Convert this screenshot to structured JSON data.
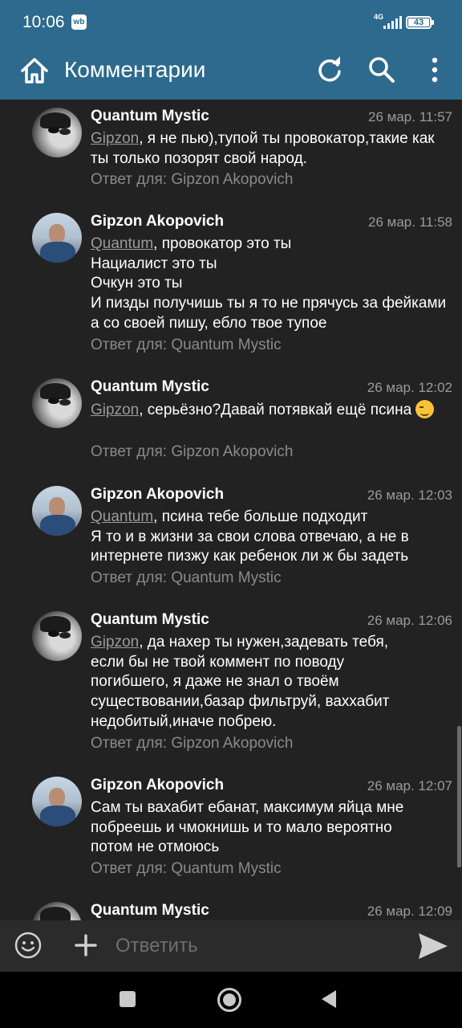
{
  "status_bar": {
    "time": "10:06",
    "app_badge": "wb",
    "network": "4G",
    "battery": "43"
  },
  "app_bar": {
    "title": "Комментарии"
  },
  "reply_prefix": "Ответ для: ",
  "comments": [
    {
      "author": "Quantum Mystic",
      "date": "26 мар. 11:57",
      "mention": "Gipzon",
      "text": ", я не пью),тупой ты провокатор,такие как ты только позорят свой народ.",
      "reply_to": "Gipzon Akopovich"
    },
    {
      "author": "Gipzon Akopovich",
      "date": "26 мар. 11:58",
      "mention": "Quantum",
      "text": ", провокатор это ты\nНациалист это ты\nОчкун это ты\nИ пизды получишь ты я то не прячусь за фейками а со своей пишу, ебло твое тупое",
      "reply_to": "Quantum Mystic"
    },
    {
      "author": "Quantum Mystic",
      "date": "26 мар. 12:02",
      "mention": "Gipzon",
      "text": ", серьёзно?Давай потявкай ещё псина",
      "emoji": "wink",
      "reply_to": "Gipzon Akopovich"
    },
    {
      "author": "Gipzon Akopovich",
      "date": "26 мар. 12:03",
      "mention": "Quantum",
      "text": ", псина тебе больше подходит\nЯ то и в жизни за свои слова отвечаю, а не в интернете пизжу как ребенок ли ж бы задеть",
      "reply_to": "Quantum Mystic"
    },
    {
      "author": "Quantum Mystic",
      "date": "26 мар. 12:06",
      "mention": "Gipzon",
      "text": ", да нахер ты нужен,задевать тебя, если бы не твой коммент по поводу погибшего, я даже не знал о твоём существовании,базар фильтруй, ваххабит недобитый,иначе побрею.",
      "reply_to": "Gipzon Akopovich"
    },
    {
      "author": "Gipzon Akopovich",
      "date": "26 мар. 12:07",
      "mention": "",
      "text": "Сам ты вахабит ебанат, максимум яйца мне побреешь и чмокнишь и то мало вероятно потом не отмоюсь",
      "reply_to": "Quantum Mystic"
    },
    {
      "author": "Quantum Mystic",
      "date": "26 мар. 12:09",
      "mention": "",
      "text": "",
      "reply_to": ""
    }
  ],
  "reply_bar": {
    "placeholder": "Ответить"
  },
  "icons": {
    "home": "home-icon",
    "refresh": "refresh-icon",
    "search": "search-icon",
    "more": "more-vertical-icon",
    "emoji": "emoji-icon",
    "add": "plus-icon",
    "send": "send-icon"
  },
  "colors": {
    "app_bar": "#2d6a8e",
    "background": "#222222",
    "meta": "#9a9a9a"
  }
}
